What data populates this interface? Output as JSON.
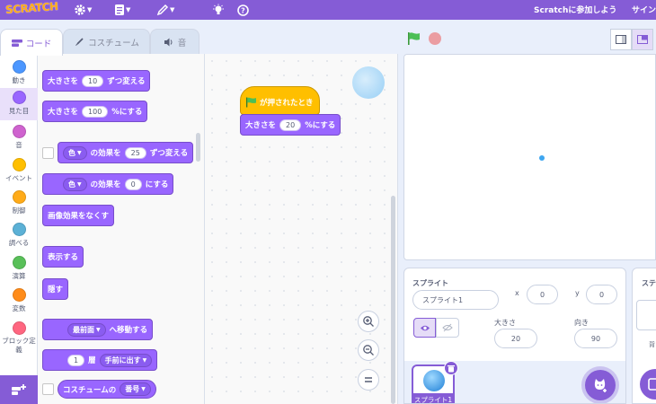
{
  "menu": {
    "logo": "SCRATCH",
    "join": "Scratchに参加しよう",
    "signin": "サイン"
  },
  "tabs": {
    "code": "コード",
    "costumes": "コスチューム",
    "sounds": "音"
  },
  "categories": [
    {
      "label": "動き",
      "color": "#4c97ff"
    },
    {
      "label": "見た目",
      "color": "#9966ff"
    },
    {
      "label": "音",
      "color": "#cf63cf"
    },
    {
      "label": "イベント",
      "color": "#ffbf00"
    },
    {
      "label": "制御",
      "color": "#ffab19"
    },
    {
      "label": "調べる",
      "color": "#5cb1d6"
    },
    {
      "label": "演算",
      "color": "#59c059"
    },
    {
      "label": "変数",
      "color": "#ff8c1a"
    },
    {
      "label": "ブロック定義",
      "color": "#ff6680"
    }
  ],
  "palette": {
    "change_size": {
      "text": "大きさを",
      "value": "10",
      "suffix": "ずつ変える"
    },
    "set_size": {
      "text": "大きさを",
      "value": "100",
      "suffix": "%にする"
    },
    "change_effect": {
      "effect": "色",
      "mid": "の効果を",
      "value": "25",
      "suffix": "ずつ変える"
    },
    "set_effect": {
      "effect": "色",
      "mid": "の効果を",
      "value": "0",
      "suffix": "にする"
    },
    "clear_effects": "画像効果をなくす",
    "show": "表示する",
    "hide": "隠す",
    "go_layer": {
      "option": "最前面",
      "suffix": "へ移動する"
    },
    "go_layers": {
      "value": "1",
      "mid": "層",
      "option": "手前に出す"
    },
    "costume_reporter": {
      "text": "コスチュームの",
      "option": "番号"
    }
  },
  "script": {
    "hat": "が押されたとき",
    "set_size": {
      "text": "大きさを",
      "value": "20",
      "suffix": "%にする"
    }
  },
  "sprite_info": {
    "title": "スプライト",
    "name": "スプライト1",
    "x_label": "x",
    "x": "0",
    "y_label": "y",
    "y": "0",
    "size_label": "大きさ",
    "size": "20",
    "direction_label": "向き",
    "direction": "90"
  },
  "sprite_list": [
    {
      "name": "スプライト1"
    }
  ],
  "stage_panel": {
    "title": "ステ",
    "backdrops_label": "背"
  },
  "colors": {
    "accent": "#855cd6",
    "looks": "#9966ff",
    "events": "#ffbf00"
  }
}
